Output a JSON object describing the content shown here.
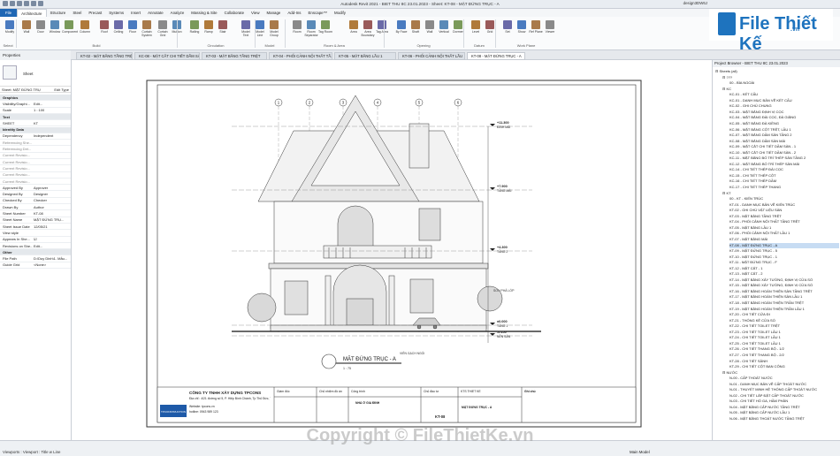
{
  "window": {
    "title": "Autodesk Revit 2021 - BIET THU 8C 23.01.2023 - Sheet: KT-08 - MẶT ĐỨNG TRỤC - A",
    "user": "design3DW6J"
  },
  "menu": [
    "File",
    "Architecture",
    "Structure",
    "Steel",
    "Precast",
    "Systems",
    "Insert",
    "Annotate",
    "Analyze",
    "Massing & Site",
    "Collaborate",
    "View",
    "Manage",
    "Add-Ins",
    "Enscape™",
    "Modify"
  ],
  "ribbon": {
    "select_label": "Select",
    "buttons": [
      "Modify",
      "Wall",
      "Door",
      "Window",
      "Component",
      "Column",
      "Roof",
      "Ceiling",
      "Floor",
      "Curtain System",
      "Curtain Grid",
      "Mullion",
      "Railing",
      "Ramp",
      "Stair",
      "Model Text",
      "Model Line",
      "Model Group",
      "Room",
      "Room Separator",
      "Tag Room",
      "Area",
      "Area Boundary",
      "Tag Area",
      "By Face",
      "Shaft",
      "Wall",
      "Vertical",
      "Dormer",
      "Level",
      "Grid",
      "Set",
      "Show",
      "Ref Plane",
      "Viewer"
    ],
    "groups": [
      "Select",
      "Build",
      "Circulation",
      "Model",
      "Room & Area",
      "Opening",
      "Datum",
      "Work Plane"
    ]
  },
  "logo": {
    "brand": "File Thiết Kế",
    "suffix": ".vn"
  },
  "view_tabs": [
    "KT-02 - MẶT BẰNG TẦNG TRỆT",
    "KC-08 - MẶT CẮT CHI TIẾT DẦM SÀ...",
    "KT-03 - MẶT BẰNG TẦNG TRỆT",
    "KT-04 - PHỐI CẢNH NỘI THẤT TẦ...",
    "KT-05 - MẶT BẰNG LẦU 1",
    "KT-06 - PHỐI CẢNH NỘI THẤT LẦU",
    "KT-08 - MẶT ĐỨNG TRỤC - A"
  ],
  "properties": {
    "title": "Properties",
    "type_name": "Sheet",
    "selector": "Sheet: MẶT ĐỨNG TRỤ",
    "edit_type": "Edit Type",
    "apply": "Apply",
    "help": "Properties help",
    "rows": [
      {
        "k": "Graphics",
        "v": "",
        "group": true
      },
      {
        "k": "Visibility/Graphi...",
        "v": "Edit..."
      },
      {
        "k": "Scale",
        "v": "1 : 100"
      },
      {
        "k": "Text",
        "v": "",
        "group": true
      },
      {
        "k": "SHEET",
        "v": "KT"
      },
      {
        "k": "Identity Data",
        "v": "",
        "group": true
      },
      {
        "k": "Dependency",
        "v": "Independent"
      },
      {
        "k": "Referencing She...",
        "v": "",
        "grey": true
      },
      {
        "k": "Referencing Det...",
        "v": "",
        "grey": true
      },
      {
        "k": "Current Revisio...",
        "v": "",
        "grey": true
      },
      {
        "k": "Current Revisio...",
        "v": "",
        "grey": true
      },
      {
        "k": "Current Revisio...",
        "v": "",
        "grey": true
      },
      {
        "k": "Current Revisio...",
        "v": "",
        "grey": true
      },
      {
        "k": "Current Revisio...",
        "v": "",
        "grey": true
      },
      {
        "k": "Approved By",
        "v": "Approver"
      },
      {
        "k": "Designed By",
        "v": "Designer"
      },
      {
        "k": "Checked By",
        "v": "Checker"
      },
      {
        "k": "Drawn By",
        "v": "Author"
      },
      {
        "k": "Sheet Number",
        "v": "KT-08"
      },
      {
        "k": "Sheet Name",
        "v": "MẶT ĐỨNG TRỤ..."
      },
      {
        "k": "Sheet Issue Date",
        "v": "12/05/21"
      },
      {
        "k": "View style",
        "v": ""
      },
      {
        "k": "Appears In She...",
        "v": "☑"
      },
      {
        "k": "Revisions on She...",
        "v": "Edit..."
      },
      {
        "k": "Other",
        "v": "",
        "group": true
      },
      {
        "k": "File Path",
        "v": "D:\\Duy Dinh\\1. Mẫu..."
      },
      {
        "k": "Guide Grid",
        "v": "<None>"
      }
    ]
  },
  "sheet": {
    "elevation_title": "MẶT ĐỨNG TRỤC - A",
    "scale_note": "1 : 75",
    "levels": [
      {
        "name": "ĐỈNH MÁI",
        "value": "+11.300"
      },
      {
        "name": "TẦNG MÁI",
        "value": "+7.900"
      },
      {
        "name": "TẦNG 2",
        "value": "+4.300"
      },
      {
        "name": "TẦNG 1",
        "value": "±0.000"
      },
      {
        "name": "NỀN SÂN",
        "value": "-0.150"
      }
    ],
    "grids": [
      "1",
      "2",
      "3",
      "4",
      "5",
      "6"
    ],
    "notes": [
      "SƠN PHẢ LỚP",
      "VIÊN GẠCH NGÓI"
    ],
    "company": "CÔNG TY TNHH XÂY DỰNG TPCONS",
    "address": "Địa chỉ : 4/21 đường số 5, P. Hiệp Bình Chánh, Tp Thủ Đức, TP.HCM",
    "website": "Website: tpcons.vn",
    "hotline": "hotline: 0943 989 123",
    "tb_labels": [
      "Giám đốc",
      "Chủ nhiệm đồ án",
      "Công trình",
      "Chủ đầu tư",
      "KTS THIẾT KẾ",
      "Ghi chú"
    ],
    "project": "NHÀ Ở GIA ĐÌNH",
    "sheet_name": "MẶT ĐỨNG TRỤC - A",
    "sheet_no": "KT-08",
    "logo_text": "TPCONSTRUCTION"
  },
  "browser": {
    "title": "Project Browser - BIET THU 8C 23.01.2023",
    "items": [
      {
        "t": "Sheets (all)",
        "lvl": 0
      },
      {
        "t": "???",
        "lvl": 1
      },
      {
        "t": "00 - BÌA NGOÀI",
        "lvl": 2
      },
      {
        "t": "KC",
        "lvl": 1
      },
      {
        "t": "KC-01 - KẾT CẤU",
        "lvl": 2
      },
      {
        "t": "KC-01 - DANH MỤC BẢN VẼ KẾT CẤU",
        "lvl": 2
      },
      {
        "t": "KC-02 - GHI CHÚ CHUNG",
        "lvl": 2
      },
      {
        "t": "KC-03 - MẶT BẰNG ĐỊNH VỊ CỌC",
        "lvl": 2
      },
      {
        "t": "KC-04 - MẶT BẰNG ĐÀI CỌC, ĐÀ GIẰNG",
        "lvl": 2
      },
      {
        "t": "KC-05 - MẶT BẰNG ĐÀ KIỀNG",
        "lvl": 2
      },
      {
        "t": "KC-06 - MẶT BẰNG CỘT TRỆT, LẦU 1",
        "lvl": 2
      },
      {
        "t": "KC-07 - MẶT BẰNG DẦM SÀN TẦNG 2",
        "lvl": 2
      },
      {
        "t": "KC-08 - MẶT BẰNG DẦM SÀN MÁI",
        "lvl": 2
      },
      {
        "t": "KC-09 - MẶT CẮT CHI TIẾT DẦM SÀN - 1",
        "lvl": 2
      },
      {
        "t": "KC-10 - MẶT CẮT CHI TIẾT DẦM SÀN - 2",
        "lvl": 2
      },
      {
        "t": "KC-11 - MẶT BẰNG BỐ TRÍ THÉP SÀN TẦNG 2",
        "lvl": 2
      },
      {
        "t": "KC-12 - MẶT BẰNG BỐ TRÍ THÉP SÀN MÁI",
        "lvl": 2
      },
      {
        "t": "KC-14 - CHI TIẾT THÉP ĐÀI CỌC",
        "lvl": 2
      },
      {
        "t": "KC-15 - CHI TIẾT THÉP CỘT",
        "lvl": 2
      },
      {
        "t": "KC-16 - CHI TIẾT THÉP DẦM",
        "lvl": 2
      },
      {
        "t": "KC-17 - CHI TIẾT THÉP THANG",
        "lvl": 2
      },
      {
        "t": "KT",
        "lvl": 1
      },
      {
        "t": "00 - KT - KIẾN TRÚC",
        "lvl": 2
      },
      {
        "t": "KT-01 - DANH MỤC BẢN VẼ KIẾN TRÚC",
        "lvl": 2
      },
      {
        "t": "KT-02 - GHI CHÚ VẬT LIỆU SÀN",
        "lvl": 2
      },
      {
        "t": "KT-03 - MẶT BẰNG TẦNG TRỆT",
        "lvl": 2
      },
      {
        "t": "KT-04 - PHỐI CẢNH NỘI THẤT TẦNG TRỆT",
        "lvl": 2
      },
      {
        "t": "KT-05 - MẶT BẰNG LẦU 1",
        "lvl": 2
      },
      {
        "t": "KT-06 - PHỐI CẢNH NỘI THẤT LẦU 1",
        "lvl": 2
      },
      {
        "t": "KT-07 - MẶT BẰNG MÁI",
        "lvl": 2
      },
      {
        "t": "KT-08 - MẶT ĐỨNG TRỤC - A",
        "lvl": 2,
        "sel": true
      },
      {
        "t": "KT-09 - MẶT ĐỨNG TRỤC - 5",
        "lvl": 2
      },
      {
        "t": "KT-10 - MẶT ĐỨNG TRỤC - 1",
        "lvl": 2
      },
      {
        "t": "KT-11 - MẶT ĐỨNG TRỤC - F",
        "lvl": 2
      },
      {
        "t": "KT-12 - MẶT CẮT - 1",
        "lvl": 2
      },
      {
        "t": "KT-13 - MẶT CẮT - 2",
        "lvl": 2
      },
      {
        "t": "KT-14 - MẶT BẰNG XÂY TƯỜNG, ĐỊNH VỊ CỬA SỔ",
        "lvl": 2
      },
      {
        "t": "KT-15 - MẶT BẰNG XÂY TƯỜNG, ĐỊNH VỊ CỬA SỔ",
        "lvl": 2
      },
      {
        "t": "KT-16 - MẶT BẰNG HOÀN THIỆN SÀN TẦNG TRỆT",
        "lvl": 2
      },
      {
        "t": "KT-17 - MẶT BẰNG HOÀN THIỆN SÀN LẦU 1",
        "lvl": 2
      },
      {
        "t": "KT-18 - MẶT BẰNG HOÀN THIỆN TRẦN TRỆT",
        "lvl": 2
      },
      {
        "t": "KT-19 - MẶT BẰNG HOÀN THIỆN TRẦN LẦU 1",
        "lvl": 2
      },
      {
        "t": "KT-20 - CHI TIẾT CỬA ĐI",
        "lvl": 2
      },
      {
        "t": "KT-21 - THỐNG KÊ CỬA SỔ",
        "lvl": 2
      },
      {
        "t": "KT-22 - CHI TIẾT TOILET TRỆT",
        "lvl": 2
      },
      {
        "t": "KT-23 - CHI TIẾT TOILET LẦU 1",
        "lvl": 2
      },
      {
        "t": "KT-24 - CHI TIẾT TOILET LẦU 1",
        "lvl": 2
      },
      {
        "t": "KT-25 - CHI TIẾT TOILET LẦU 1",
        "lvl": 2
      },
      {
        "t": "KT-26 - CHI TIẾT THANG BỘ - 1/2",
        "lvl": 2
      },
      {
        "t": "KT-27 - CHI TIẾT THANG BỘ - 2/2",
        "lvl": 2
      },
      {
        "t": "KT-28 - CHI TIẾT SẢNH",
        "lvl": 2
      },
      {
        "t": "KT-29 - CHI TIẾT CỘT BAN CÔNG",
        "lvl": 2
      },
      {
        "t": "NƯỚC",
        "lvl": 1
      },
      {
        "t": "N-00 - CẤP THOÁT NƯỚC",
        "lvl": 2
      },
      {
        "t": "N-01 - DANH MỤC BẢN VẼ CẤP THOÁT NƯỚC",
        "lvl": 2
      },
      {
        "t": "N-01 - THUYẾT MINH HỆ THỐNG CẤP THOÁT NƯỚC",
        "lvl": 2
      },
      {
        "t": "N-02 - CHI TIẾT LẮP ĐẶT CẤP THOÁT NƯỚC",
        "lvl": 2
      },
      {
        "t": "N-03 - CHI TIẾT HỐ GA, HẦM PHÂN",
        "lvl": 2
      },
      {
        "t": "N-04 - MẶT BẰNG CẤP NƯỚC TẦNG TRỆT",
        "lvl": 2
      },
      {
        "t": "N-05 - MẶT BẰNG CẤP NƯỚC LẦU 1",
        "lvl": 2
      },
      {
        "t": "N-06 - MẶT BẰNG THOÁT NƯỚC TẦNG TRỆT",
        "lvl": 2
      }
    ]
  },
  "status": {
    "text": "Viewports : Viewport : Title w Line",
    "model": "Main Model"
  },
  "watermark": "Copyright © FileThietKe.vn"
}
